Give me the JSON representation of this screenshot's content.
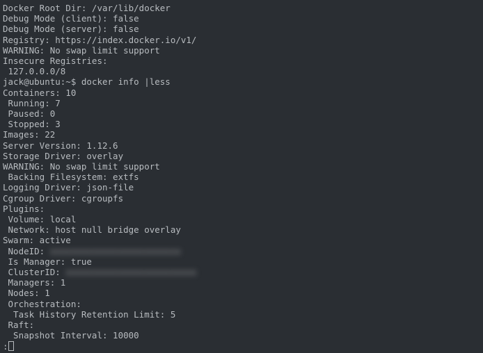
{
  "scrollback": {
    "docker_root_dir": "Docker Root Dir: /var/lib/docker",
    "debug_client": "Debug Mode (client): false",
    "debug_server": "Debug Mode (server): false",
    "registry": "Registry: https://index.docker.io/v1/",
    "warning1": "WARNING: No swap limit support",
    "insecure_reg": "Insecure Registries:",
    "insecure_ip": " 127.0.0.0/8"
  },
  "prompt": {
    "userhost": "jack@ubuntu:~$ ",
    "command": "docker info |less"
  },
  "output": {
    "containers": "Containers: 10",
    "running": " Running: 7",
    "paused": " Paused: 0",
    "stopped": " Stopped: 3",
    "images": "Images: 22",
    "server_version": "Server Version: 1.12.6",
    "storage_driver": "Storage Driver: overlay",
    "warning2": "WARNING: No swap limit support",
    "backing_fs": " Backing Filesystem: extfs",
    "logging_driver": "Logging Driver: json-file",
    "cgroup_driver": "Cgroup Driver: cgroupfs",
    "plugins": "Plugins:",
    "volume": " Volume: local",
    "network": " Network: host null bridge overlay",
    "swarm": "Swarm: active",
    "nodeid_label": " NodeID: ",
    "nodeid_val": "xxxxxxxxxxxxxxxxxxxxxxxxx",
    "is_manager": " Is Manager: true",
    "clusterid_label": " ClusterID: ",
    "clusterid_val": "xxxxxxxxxxxxxxxxxxxxxxxxx",
    "managers": " Managers: 1",
    "nodes": " Nodes: 1",
    "orchestration": " Orchestration:",
    "task_history": "  Task History Retention Limit: 5",
    "raft": " Raft:",
    "snapshot": "  Snapshot Interval: 10000"
  },
  "pager": {
    "prompt": ":"
  }
}
